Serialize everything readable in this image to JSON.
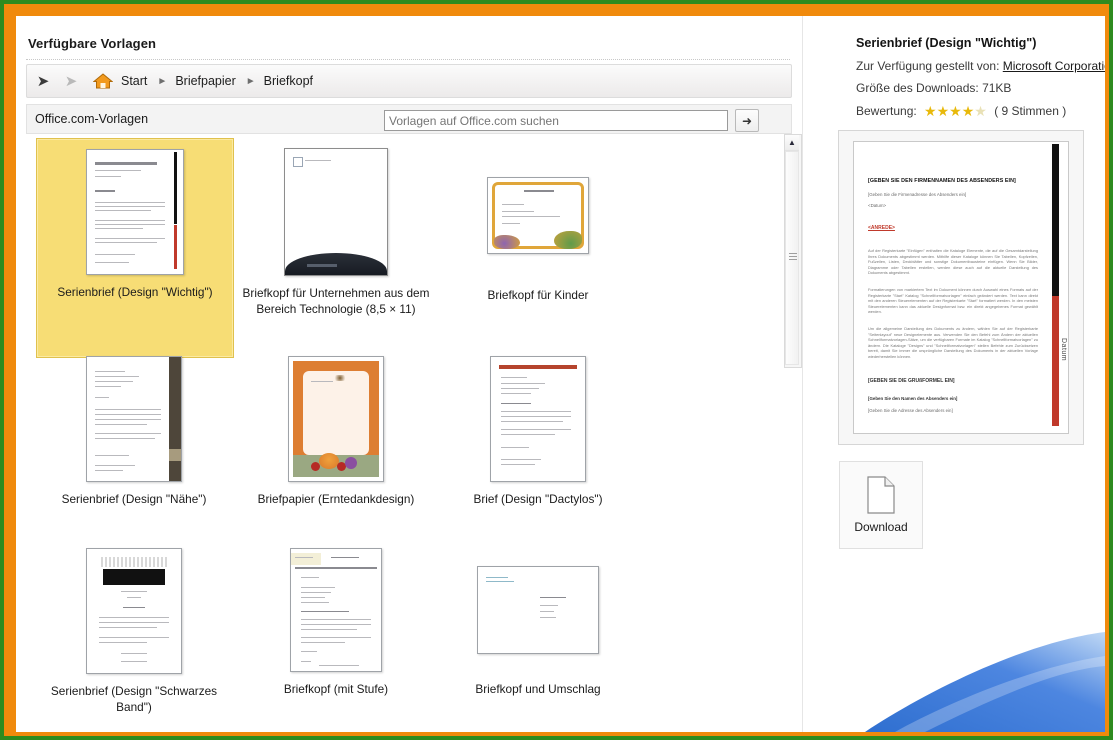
{
  "window": {
    "pane_title": "Verfügbare Vorlagen",
    "border_green": "#2e8b1f",
    "border_orange": "#f08a0c"
  },
  "breadcrumb": {
    "back_icon": "arrow-left-icon",
    "forward_icon": "arrow-right-icon",
    "home_icon": "home-icon",
    "items": [
      "Start",
      "Briefpapier",
      "Briefkopf"
    ],
    "separator": "►"
  },
  "office_bar": {
    "label": "Office.com-Vorlagen",
    "search_placeholder": "Vorlagen auf Office.com suchen",
    "search_value": "",
    "search_button_icon": "arrow-right-icon"
  },
  "templates": [
    {
      "caption": "Serienbrief (Design \"Wichtig\")",
      "selected": true
    },
    {
      "caption": "Briefkopf für Unternehmen aus dem Bereich Technologie (8,5 × 11)",
      "selected": false
    },
    {
      "caption": "Briefkopf für Kinder",
      "selected": false
    },
    {
      "caption": "Serienbrief (Design \"Nähe\")",
      "selected": false
    },
    {
      "caption": "Briefpapier (Erntedankdesign)",
      "selected": false
    },
    {
      "caption": "Brief (Design \"Dactylos\")",
      "selected": false
    },
    {
      "caption": "Serienbrief (Design \"Schwarzes Band\")",
      "selected": false
    },
    {
      "caption": "Briefkopf (mit Stufe)",
      "selected": false
    },
    {
      "caption": "Briefkopf und Umschlag",
      "selected": false
    }
  ],
  "scrollbar": {
    "up_icon": "triangle-up-icon",
    "grip_icon": "grip-icon"
  },
  "details": {
    "title": "Serienbrief (Design \"Wichtig\")",
    "provider_label": "Zur Verfügung gestellt von:",
    "provider_name": "Microsoft Corporation",
    "size_label": "Größe des Downloads:",
    "size_value": "71KB",
    "rating_label": "Bewertung:",
    "stars_filled": 4,
    "stars_total": 5,
    "votes": "( 9 Stimmen )"
  },
  "preview": {
    "heading": "[GEBEN SIE DEN FIRMENNAMEN DES ABSENDERS EIN]",
    "subheading": "[Geben Sie die Firmenadresse des Absenders ein]",
    "date_line": "<Datum>",
    "salutation": "<ANREDE>",
    "paragraph1": "Auf der Registerkarte \"Einfügen\" enthalten die Kataloge Elemente, die auf die Gesamtdarstellung Ihres Dokuments abgestimmt werden. Mithilfe dieser Kataloge können Sie Tabellen, Kopfzeilen, Fußzeilen, Listen, Deckblätter und sonstige Dokumentbausteine einfügen. Wenn Sie Bilder, Diagramme oder Tabellen erstellen, werden diese auch auf die aktuelle Darstellung des Dokuments abgestimmt.",
    "paragraph2": "Formatierungen von markiertem Text im Dokument können durch Auswahl eines Formats auf der Registerkarte \"Start\" Katalog \"Schnellformatvorlagen\" einfach geändert werden. Text kann direkt mit den anderen Steuerelementen auf der Registerkarte \"Start\" formatiert werden. In den meisten Steuerelementen kann das aktuelle Designformat bzw. ein direkt angegebenes Format gewählt werden.",
    "paragraph3": "Um die allgemeine Darstellung des Dokuments zu ändern, wählen Sie auf der Registerkarte \"Seitenlayout\" neue Designelemente aus. Verwenden Sie den Befehl zum Ändern der aktuellen Schnellformatvorlagen-Sätze, um die verfügbaren Formate im Katalog \"Schnellformatvorlagen\" zu ändern. Die Kataloge \"Designs\" und \"Schnellformatvorlagen\" stellen Befehle zum Zurücksetzen bereit, damit Sie immer die ursprüngliche Darstellung des Dokuments in der aktuellen Vorlage wiederherstellen können.",
    "closing": "[GEBEN SIE DIE GRUßFORMEL EIN]",
    "sender_name": "[Geben Sie den Namen des Absenders ein]",
    "sender_address": "[Geben Sie die Adresse des Absenders ein]",
    "side_label": "Datum"
  },
  "download": {
    "icon": "document-icon",
    "label": "Download"
  }
}
